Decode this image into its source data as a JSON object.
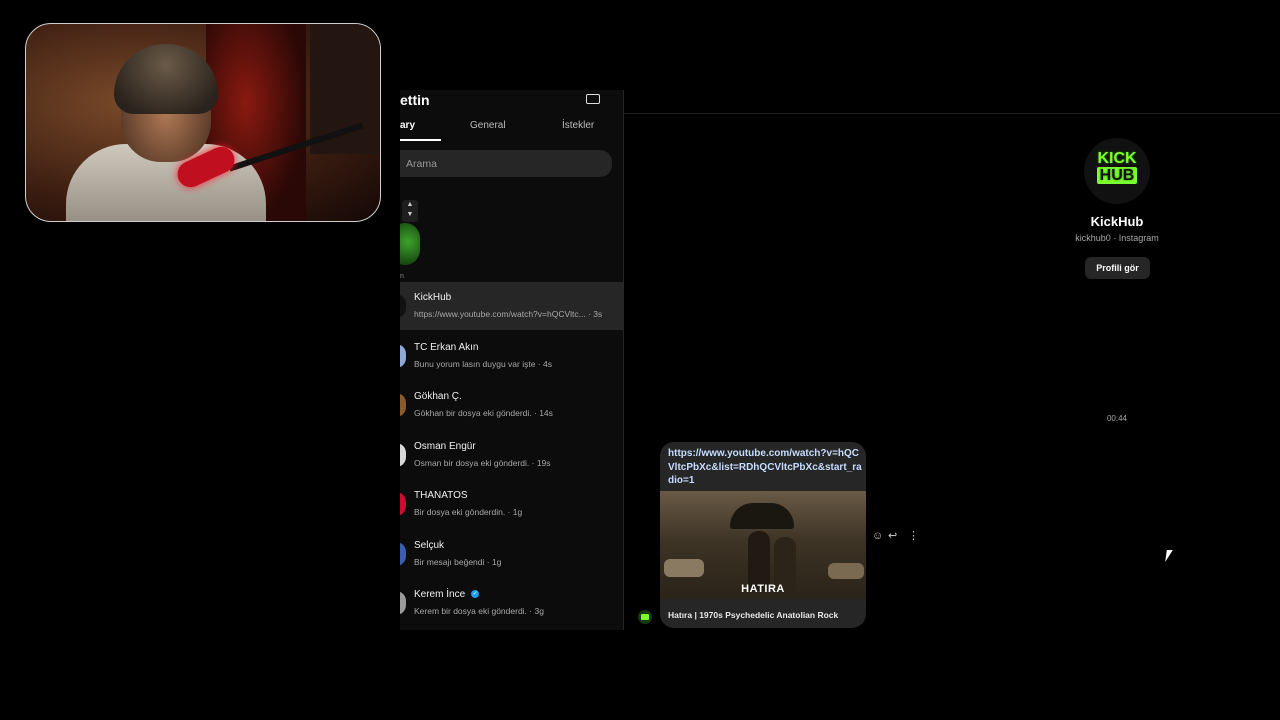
{
  "inbox": {
    "title": "ettin",
    "tabs": [
      "ary",
      "General",
      "İstekler"
    ],
    "search_placeholder": "Arama",
    "note_label": "n",
    "threads": [
      {
        "name": "KickHub",
        "preview": "https://www.youtube.com/watch?v=hQCVltc... · 3s",
        "avatar_color": "#111111",
        "active": true
      },
      {
        "name": "TC Erkan Akın",
        "preview": "Bunu yorum lasın duygu var işte · 4s",
        "avatar_color": "#8fa8d6"
      },
      {
        "name": "Gökhan Ç.",
        "preview": "Gökhan bir dosya eki gönderdi. · 14s",
        "avatar_color": "#8a5a2a"
      },
      {
        "name": "Osman Engür",
        "preview": "Osman bir dosya eki gönderdi. · 19s",
        "avatar_color": "#d8d8d8"
      },
      {
        "name": "THANATOS",
        "preview": "Bir dosya eki gönderdin. · 1g",
        "avatar_color": "#c8102e"
      },
      {
        "name": "Selçuk",
        "preview": "Bir mesajı beğendi · 1g",
        "avatar_color": "#3a5fb0"
      },
      {
        "name": "Kerem İnce",
        "preview": "Kerem bir dosya eki gönderdi. · 3g",
        "avatar_color": "#9a9a9a",
        "verified": true
      }
    ]
  },
  "profile": {
    "logo_line1": "KICK",
    "logo_line2": "HUB",
    "name": "KickHub",
    "handle": "kickhub0 · Instagram",
    "view_profile_button": "Profili gör"
  },
  "conversation": {
    "timestamp": "00:44",
    "message": {
      "link": "https://www.youtube.com/watch?v=hQCVltcPbXc&list=RDhQCVltcPbXc&start_radio=1",
      "thumbnail_caption": "HATIRA",
      "video_title": "Hatıra | 1970s Psychedelic Anatolian Rock"
    },
    "actions": {
      "react_icon": "☺",
      "reply_icon": "↩",
      "more_icon": "⋮"
    }
  },
  "colors": {
    "background": "#000000",
    "panel": "#0c0c0c",
    "active_row": "#262626",
    "link": "#c6dcff",
    "kick_green": "#7cff2e"
  }
}
